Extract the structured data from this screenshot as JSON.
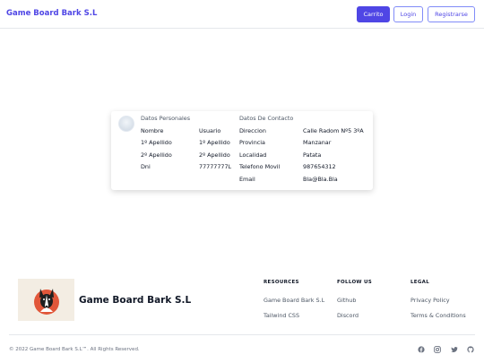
{
  "header": {
    "brand": "Game Board Bark S.L",
    "cart_label": "Carrito",
    "login_label": "Login",
    "register_label": "Registrarse"
  },
  "profile": {
    "personal_heading": "Datos Personales",
    "contact_heading": "Datos De Contacto",
    "personal_fields": [
      {
        "label": "Nombre",
        "value": "Usuario"
      },
      {
        "label": "1º Apellido",
        "value": "1º Apellido"
      },
      {
        "label": "2º Apellido",
        "value": "2º Apellido"
      },
      {
        "label": "Dni",
        "value": "77777777L"
      }
    ],
    "contact_fields": [
      {
        "label": "Direccion",
        "value": "Calle Radom Nº5 3ºA"
      },
      {
        "label": "Provincia",
        "value": "Manzanar"
      },
      {
        "label": "Localidad",
        "value": "Patata"
      },
      {
        "label": "Telefono Movil",
        "value": "987654312"
      },
      {
        "label": "Email",
        "value": "Bla@Bla.Bla"
      }
    ]
  },
  "footer": {
    "brand": "Game Board Bark S.L",
    "columns": [
      {
        "heading": "RESOURCES",
        "links": [
          "Game Board Bark S.L",
          "Tailwind CSS"
        ]
      },
      {
        "heading": "FOLLOW US",
        "links": [
          "Github",
          "Discord"
        ]
      },
      {
        "heading": "LEGAL",
        "links": [
          "Privacy Policy",
          "Terms & Conditions"
        ]
      }
    ],
    "copyright": "© 2022 Game Board Bark S.L™. All Rights Reserved.",
    "social_icons": [
      "facebook-icon",
      "instagram-icon",
      "twitter-icon",
      "github-icon"
    ]
  },
  "colors": {
    "accent": "#4f46e5",
    "accent_border": "#818cf8",
    "logo_background": "#f3ede3",
    "logo_circle": "#e1573a"
  }
}
